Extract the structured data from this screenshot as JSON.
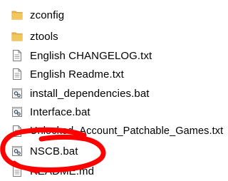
{
  "files": [
    {
      "name": "zconfig",
      "type": "folder",
      "icon": "folder-icon"
    },
    {
      "name": "ztools",
      "type": "folder",
      "icon": "folder-icon"
    },
    {
      "name": "English CHANGELOG.txt",
      "type": "text",
      "icon": "text-file-icon"
    },
    {
      "name": "English Readme.txt",
      "type": "text",
      "icon": "text-file-icon"
    },
    {
      "name": "install_dependencies.bat",
      "type": "batch",
      "icon": "batch-file-icon"
    },
    {
      "name": "Interface.bat",
      "type": "batch",
      "icon": "batch-file-icon"
    },
    {
      "name": "Unlocked_Account_Patchable_Games.txt",
      "type": "text",
      "icon": "text-file-icon"
    },
    {
      "name": "NSCB.bat",
      "type": "batch",
      "icon": "batch-file-icon"
    },
    {
      "name": "README.md",
      "type": "text",
      "icon": "text-file-icon"
    }
  ],
  "colors": {
    "folder": "#e8b84a",
    "folder_dark": "#d9a233",
    "annotation_red": "#ff0000"
  }
}
